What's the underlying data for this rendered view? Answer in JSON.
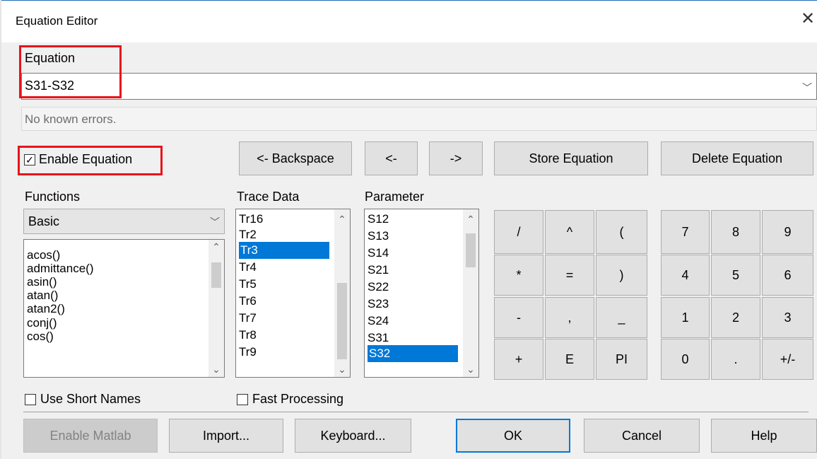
{
  "window": {
    "title": "Equation Editor",
    "close_symbol": "✕"
  },
  "equation": {
    "label": "Equation",
    "value": "S31-S32",
    "status": "No known errors."
  },
  "enable_equation": {
    "label": "Enable Equation",
    "checked": true
  },
  "toolbar": {
    "backspace": "<- Backspace",
    "left": "<-",
    "right": "->",
    "store": "Store Equation",
    "delete": "Delete Equation"
  },
  "functions": {
    "label": "Functions",
    "category": "Basic",
    "items": [
      "acos()",
      "admittance()",
      "asin()",
      "atan()",
      "atan2()",
      "conj()",
      "cos()"
    ]
  },
  "trace_data": {
    "label": "Trace Data",
    "items": [
      "Tr16",
      "Tr2",
      "Tr3",
      "Tr4",
      "Tr5",
      "Tr6",
      "Tr7",
      "Tr8",
      "Tr9"
    ],
    "selected": "Tr3"
  },
  "parameter": {
    "label": "Parameter",
    "items": [
      "S12",
      "S13",
      "S14",
      "S21",
      "S22",
      "S23",
      "S24",
      "S31",
      "S32"
    ],
    "selected": "S32"
  },
  "operators": [
    [
      "/",
      "^",
      "("
    ],
    [
      "*",
      "=",
      ")"
    ],
    [
      "-",
      ",",
      "_"
    ],
    [
      "+",
      "E",
      "PI"
    ]
  ],
  "keypad": [
    [
      "7",
      "8",
      "9"
    ],
    [
      "4",
      "5",
      "6"
    ],
    [
      "1",
      "2",
      "3"
    ],
    [
      "0",
      ".",
      "+/-"
    ]
  ],
  "options": {
    "short_names": "Use Short Names",
    "fast_processing": "Fast Processing"
  },
  "footer": {
    "matlab": "Enable Matlab",
    "import": "Import...",
    "keyboard": "Keyboard...",
    "ok": "OK",
    "cancel": "Cancel",
    "help": "Help"
  },
  "colors": {
    "selection": "#0078d7",
    "highlight_box": "#e8141a",
    "default_button": "#0078d7"
  }
}
